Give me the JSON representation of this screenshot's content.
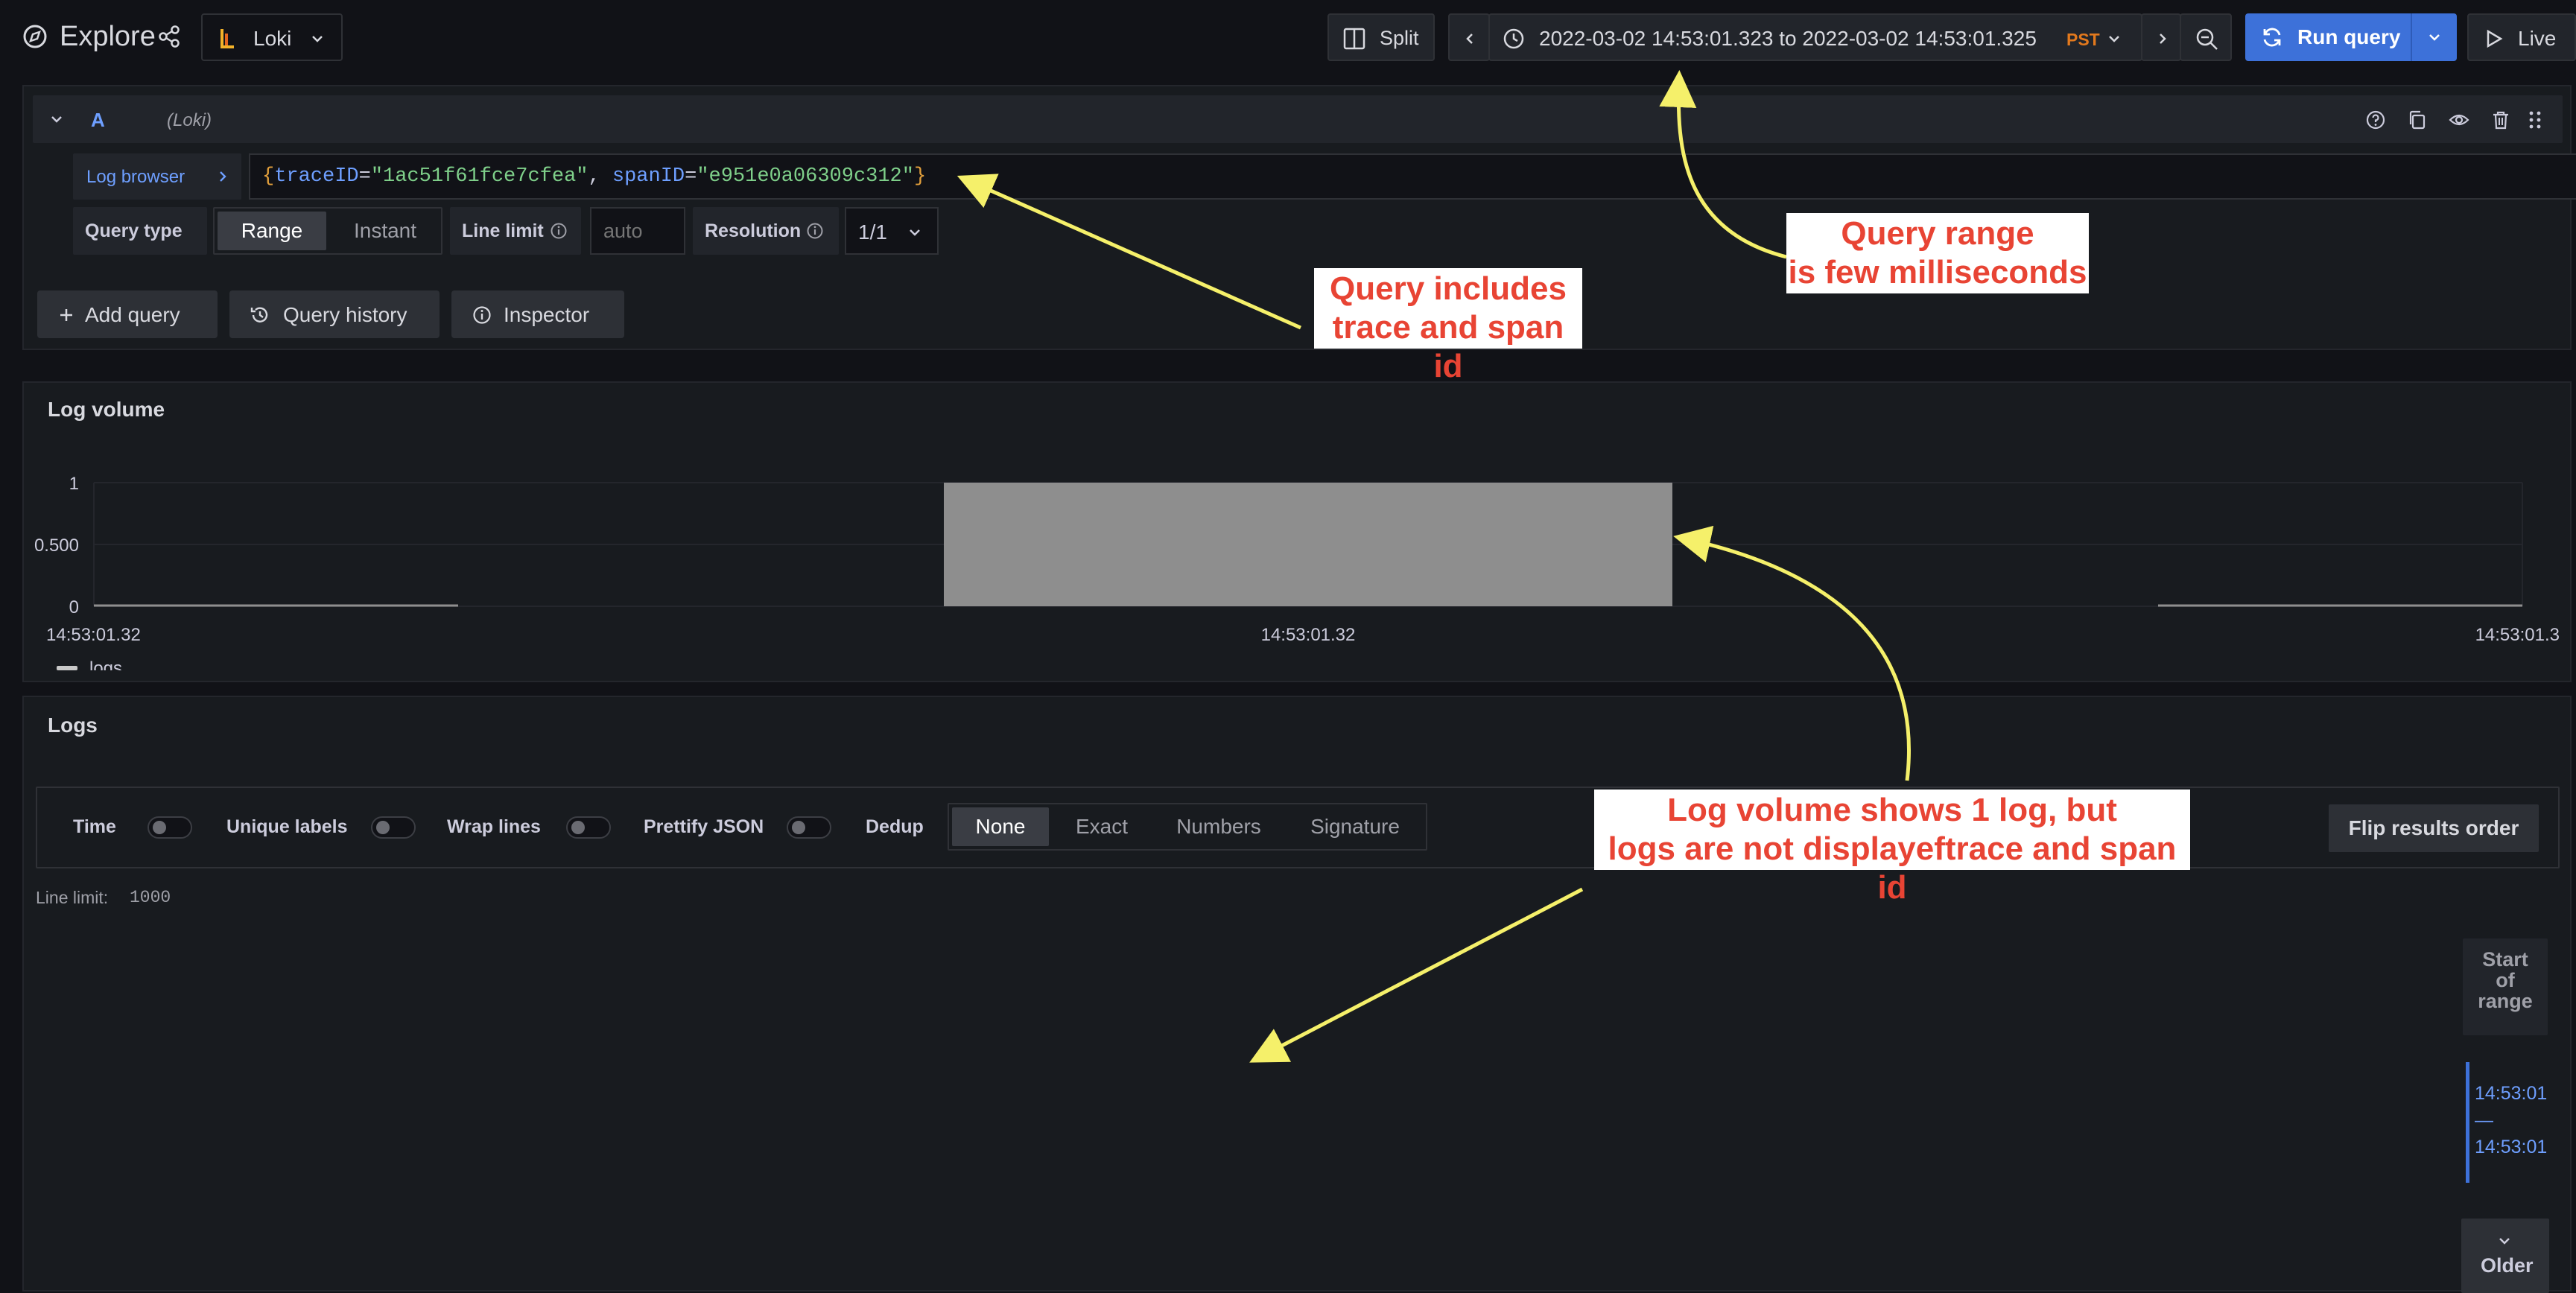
{
  "header": {
    "title": "Explore",
    "datasource": "Loki",
    "split_label": "Split",
    "time_range": "2022-03-02 14:53:01.323 to 2022-03-02 14:53:01.325",
    "timezone": "PST",
    "run_query_label": "Run query",
    "live_label": "Live"
  },
  "query": {
    "refid": "A",
    "datasource_hint": "(Loki)",
    "log_browser_label": "Log browser",
    "expr": {
      "open": "{",
      "k1": "traceID",
      "eq1": "=",
      "v1": "\"1ac51f61fce7cfea\"",
      "sep": ", ",
      "k2": "spanID",
      "eq2": "=",
      "v2": "\"e951e0a06309c312\"",
      "close": "}"
    },
    "query_type_label": "Query type",
    "range_label": "Range",
    "instant_label": "Instant",
    "line_limit_label": "Line limit",
    "line_limit_placeholder": "auto",
    "resolution_label": "Resolution",
    "resolution_value": "1/1"
  },
  "actions": {
    "add_query": "Add query",
    "query_history": "Query history",
    "inspector": "Inspector"
  },
  "volume": {
    "title": "Log volume",
    "legend": "logs"
  },
  "chart_data": {
    "type": "bar",
    "title": "",
    "xlabel": "",
    "ylabel": "",
    "ytick_labels": [
      "1",
      "0.500",
      "0"
    ],
    "xtick_labels": [
      "14:53:01.32",
      "14:53:01.32",
      "14:53:01.3"
    ],
    "ylim": [
      0,
      1
    ],
    "xlim": [
      0,
      1
    ],
    "grid": true,
    "legend_placement": "bottom-left",
    "series": [
      {
        "name": "logs",
        "color": "#8e8e8e",
        "bars": [
          {
            "start": 0.35,
            "end": 0.65,
            "value": 1
          }
        ],
        "baseline_segments": [
          [
            0.0,
            0.15
          ],
          [
            0.85,
            1.0
          ]
        ]
      }
    ]
  },
  "logs": {
    "title": "Logs",
    "time_label": "Time",
    "unique_labels_label": "Unique labels",
    "wrap_lines_label": "Wrap lines",
    "prettify_json_label": "Prettify JSON",
    "dedup_label": "Dedup",
    "dedup_options": [
      "None",
      "Exact",
      "Numbers",
      "Signature"
    ],
    "flip_label": "Flip results order",
    "line_limit_label": "Line limit:",
    "line_limit_value": "1000",
    "start_of_range": [
      "Start",
      "of",
      "range"
    ],
    "range_from": "14:53:01",
    "range_dash": "—",
    "range_to": "14:53:01",
    "older_label": "Older"
  },
  "annotations": {
    "query_range": [
      "Query range",
      "is few milliseconds"
    ],
    "query_includes": [
      "Query includes",
      "trace and span id"
    ],
    "log_volume": [
      "Log volume shows 1 log, but",
      "logs are not displayeftrace and span id"
    ],
    "arrow_color": "#f5f06a"
  }
}
